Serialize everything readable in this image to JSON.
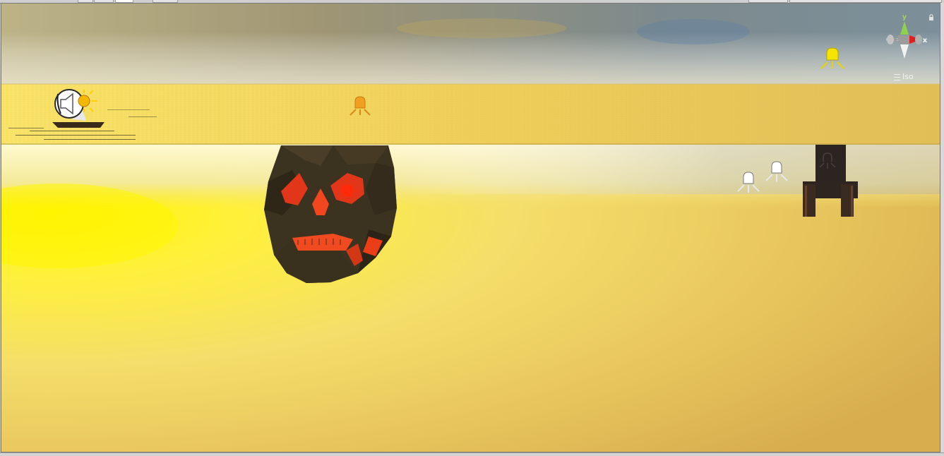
{
  "window": {
    "top_tabs": [
      {
        "name": "tab-1"
      },
      {
        "name": "tab-2"
      },
      {
        "name": "tab-3"
      },
      {
        "name": "tab-4"
      }
    ]
  },
  "scene_view": {
    "projection_label": "Iso",
    "axis_gizmo": {
      "y_label": "y",
      "x_label": "x",
      "y_color": "#8fd14f",
      "x_color": "#e02020",
      "neutral_color": "#9b9b9b"
    },
    "sky_colors": [
      "#b7aa7a",
      "#7f8d96",
      "#d8d0a5"
    ],
    "water_color": "#f2c94c",
    "ground_colors": [
      "#fff43a",
      "#f0d05e",
      "#d5ac4f"
    ],
    "light_gizmo_color": "#f5e400",
    "icons": {
      "audio": "audio-source-icon",
      "directional_light": "directional-light-icon",
      "point_lights": [
        "point-light-icon",
        "point-light-icon",
        "point-light-icon",
        "point-light-icon"
      ],
      "skull": "skull-model",
      "boat": "boat-model",
      "tower": "tower-model"
    }
  }
}
